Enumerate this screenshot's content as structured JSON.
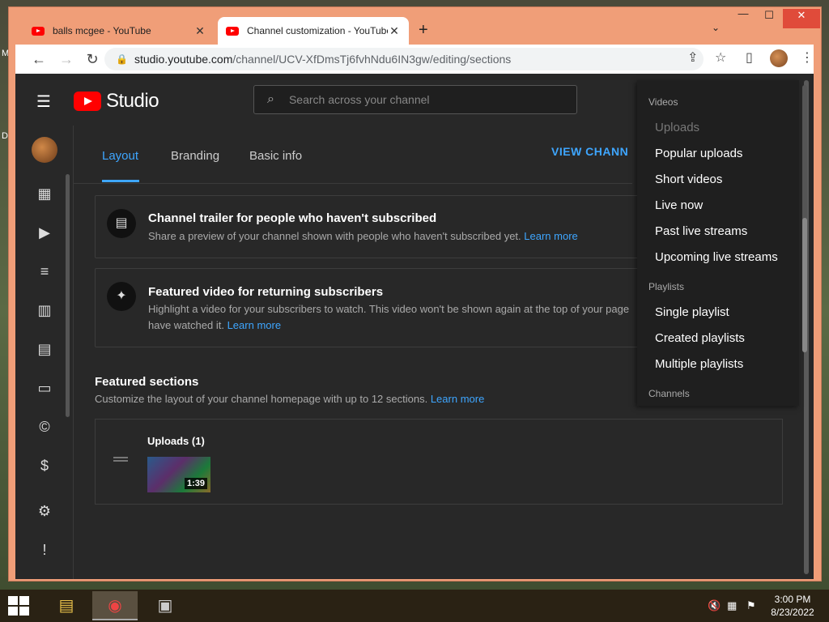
{
  "browser": {
    "tabs": [
      {
        "title": "balls mcgee - YouTube",
        "close": "✕"
      },
      {
        "title": "Channel customization - YouTube Studio",
        "close": "✕"
      }
    ],
    "new_tab": "+",
    "url_host": "studio.youtube.com",
    "url_path": "/channel/UCV-XfDmsTj6fvhNdu6IN3gw/editing/sections"
  },
  "studio": {
    "logo_text": "Studio",
    "search_placeholder": "Search across your channel",
    "tabs": [
      "Layout",
      "Branding",
      "Basic info"
    ],
    "view_channel": "VIEW CHANNEL",
    "trailer": {
      "title": "Channel trailer for people who haven't subscribed",
      "desc": "Share a preview of your channel shown with people who haven't subscribed yet.",
      "link": "Learn more"
    },
    "featured_video": {
      "title": "Featured video for returning subscribers",
      "desc": "Highlight a video for your subscribers to watch. This video won't be shown again at the top of your page",
      "desc2": "have watched it.",
      "link": "Learn more"
    },
    "featured_sections": {
      "title": "Featured sections",
      "desc": "Customize the layout of your channel homepage with up to 12 sections.",
      "link": "Learn more"
    },
    "uploads_section": {
      "title": "Uploads (1)",
      "duration": "1:39"
    }
  },
  "menu": {
    "groups": [
      {
        "label": "Videos",
        "items": [
          {
            "label": "Uploads",
            "disabled": true
          },
          {
            "label": "Popular uploads"
          },
          {
            "label": "Short videos"
          },
          {
            "label": "Live now"
          },
          {
            "label": "Past live streams"
          },
          {
            "label": "Upcoming live streams"
          }
        ]
      },
      {
        "label": "Playlists",
        "items": [
          {
            "label": "Single playlist"
          },
          {
            "label": "Created playlists"
          },
          {
            "label": "Multiple playlists"
          }
        ]
      },
      {
        "label": "Channels",
        "items": []
      }
    ]
  },
  "taskbar": {
    "time": "3:00 PM",
    "date": "8/23/2022"
  }
}
